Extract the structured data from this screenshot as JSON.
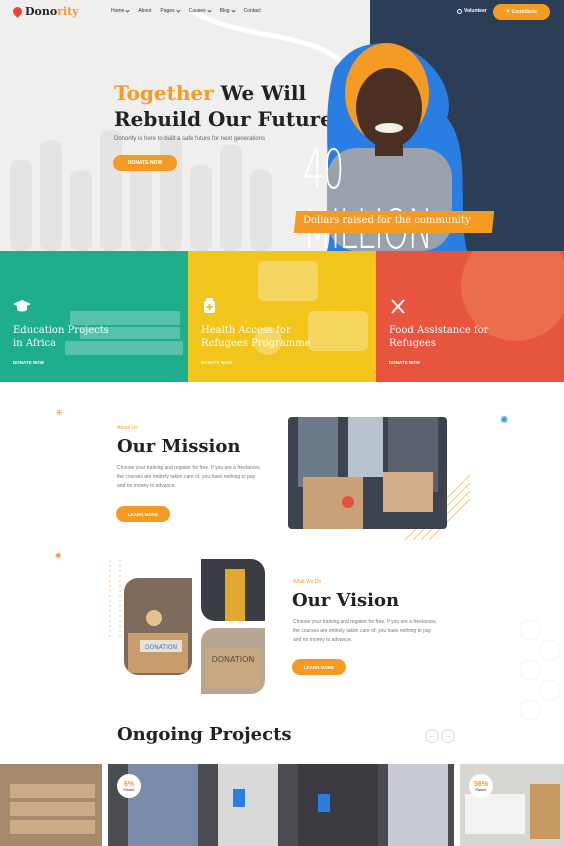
{
  "brand": {
    "name_prefix": "Dono",
    "name_suffix": "rity"
  },
  "nav": {
    "items": [
      {
        "label": "Home",
        "dropdown": true
      },
      {
        "label": "About",
        "dropdown": false
      },
      {
        "label": "Pages",
        "dropdown": true
      },
      {
        "label": "Causes",
        "dropdown": true
      },
      {
        "label": "Blog",
        "dropdown": true
      },
      {
        "label": "Contact",
        "dropdown": false
      }
    ],
    "volunteer": "Volunteer",
    "contribute": "Contribute"
  },
  "hero": {
    "title_highlight": "Together",
    "title_rest_line1": " We Will",
    "title_line2": "Rebuild Our Future",
    "subtitle": "Donority is here to built a safe future for next generations",
    "cta": "DONATE NOW",
    "stat_value": "40 MILLION",
    "stat_label": "Dollars raised for the community"
  },
  "causes": [
    {
      "title_line1": "Education Projects",
      "title_line2": "in Africa",
      "link": "DONATE NOW",
      "color": "#1fae8c",
      "icon": "graduation-cap-icon"
    },
    {
      "title_line1": "Health Access for",
      "title_line2": "Refugees Programme",
      "link": "DONATE NOW",
      "color": "#f2c51c",
      "icon": "medicine-icon"
    },
    {
      "title_line1": "Food Assistance for",
      "title_line2": "Refugees",
      "link": "DONATE NOW",
      "color": "#e8553f",
      "icon": "utensils-icon"
    }
  ],
  "mission": {
    "eyebrow": "About Us",
    "title": "Our Mission",
    "text": "Choose your training and register for free. If you are a freelancer, the courses are entirely taken care of, you have nothing to pay and no money to advance.",
    "cta": "LEARN MORE"
  },
  "vision": {
    "eyebrow": "What We Do",
    "title": "Our Vision",
    "text": "Choose your training and register for free. If you are a freelancer, the courses are entirely taken care of, you have nothing to pay and no money to advance.",
    "cta": "LEARN MORE",
    "box_label_1": "DONATION",
    "box_label_2": "DONATION"
  },
  "projects": {
    "title": "Ongoing Projects",
    "items": [
      {
        "percent": "6%",
        "label": "Raised"
      },
      {
        "percent": "56%",
        "label": "Raised"
      }
    ]
  },
  "colors": {
    "accent": "#f59a23",
    "dark": "#2c3e56",
    "teal": "#1fae8c",
    "yellow": "#f2c51c",
    "red": "#e8553f"
  }
}
